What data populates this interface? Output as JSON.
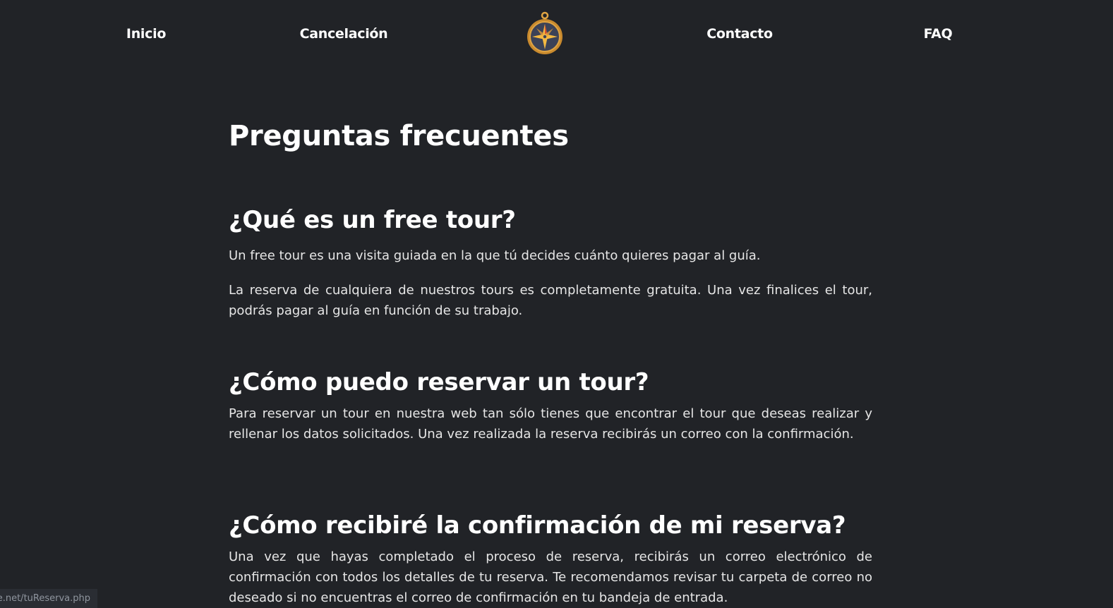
{
  "nav": {
    "inicio": "Inicio",
    "cancelacion": "Cancelación",
    "contacto": "Contacto",
    "faq": "FAQ"
  },
  "logo": {
    "icon": "compass-icon",
    "colors": {
      "gold": "#c98a2e",
      "ring": "#e0a443",
      "face": "#3c4257",
      "star": "#f4b942",
      "red": "#d94f2b"
    }
  },
  "page": {
    "title": "Preguntas frecuentes"
  },
  "faqs": [
    {
      "question": "¿Qué es un free tour?",
      "paragraphs": [
        "Un free tour es una visita guiada en la que tú decides cuánto quieres pagar al guía.",
        "La reserva de cualquiera de nuestros tours es completamente gratuita. Una vez finalices el tour, podrás pagar al guía en función de su trabajo."
      ]
    },
    {
      "question": "¿Cómo puedo reservar un tour?",
      "paragraphs": [
        "Para reservar un tour en nuestra web tan sólo tienes que encontrar el tour que deseas realizar y rellenar los datos solicitados. Una vez realizada la reserva recibirás un correo con la confirmación."
      ]
    },
    {
      "question": "¿Cómo recibiré la confirmación de mi reserva?",
      "paragraphs": [
        "Una vez que hayas completado el proceso de reserva, recibirás un correo electrónico de confirmación con todos los detalles de tu reserva. Te recomendamos revisar tu carpeta de correo no deseado si no encuentras el correo de confirmación en tu bandeja de entrada."
      ]
    }
  ],
  "status_bar": {
    "url": "e.net/tuReserva.php"
  },
  "colors": {
    "background": "#212327",
    "text": "#ffffff"
  }
}
